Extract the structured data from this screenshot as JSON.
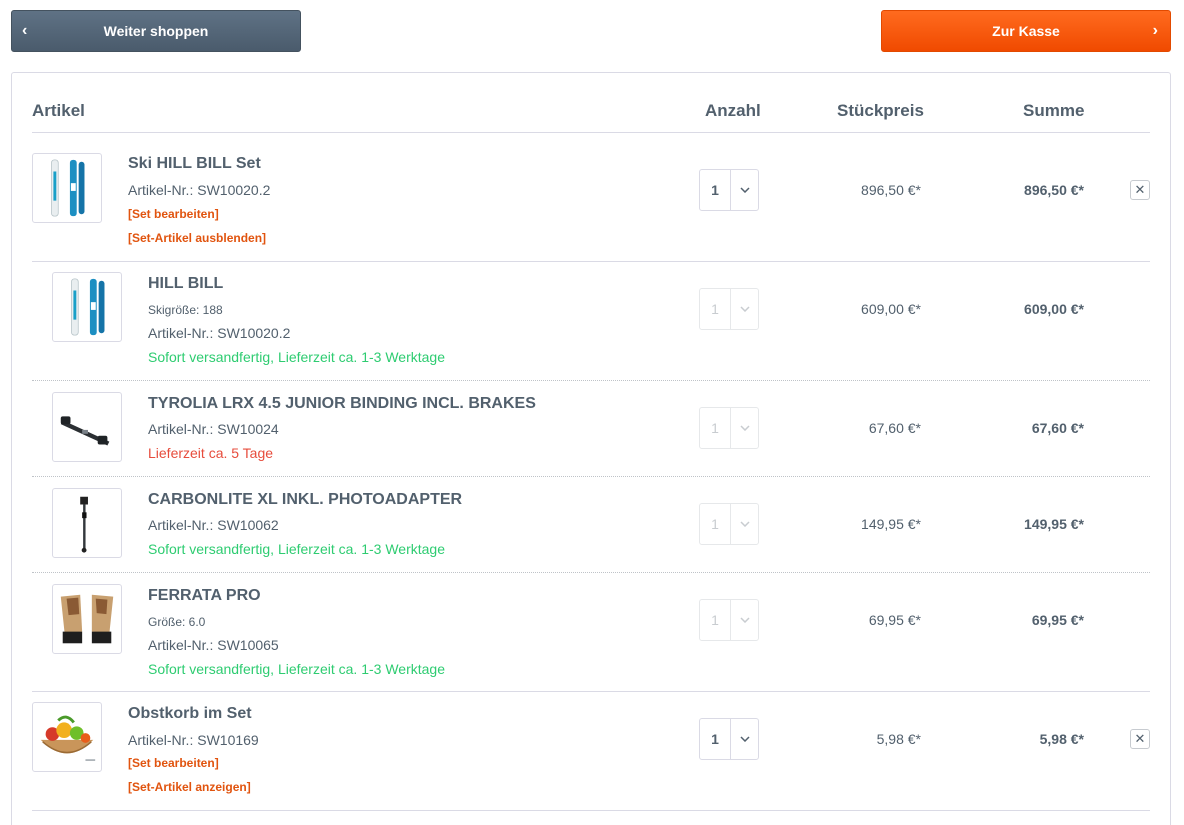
{
  "top_bar": {
    "back_label": "Weiter shoppen",
    "checkout_label": "Zur Kasse"
  },
  "table_header": {
    "artikel": "Artikel",
    "anzahl": "Anzahl",
    "stueckpreis": "Stückpreis",
    "summe": "Summe"
  },
  "items": [
    {
      "name": "Ski HILL BILL Set",
      "article_no": "Artikel-Nr.: SW10020.2",
      "edit_set": "[Set bearbeiten]",
      "toggle_set": "[Set-Artikel ausblenden]",
      "qty": "1",
      "unit_price": "896,50 €*",
      "total": "896,50 €*",
      "remove_icon": "close-icon"
    },
    {
      "name": "HILL BILL",
      "variant": "Skigröße: 188",
      "article_no": "Artikel-Nr.: SW10020.2",
      "delivery": "Sofort versandfertig, Lieferzeit ca. 1-3 Werktage",
      "qty": "1",
      "unit_price": "609,00 €*",
      "total": "609,00 €*"
    },
    {
      "name": "TYROLIA LRX 4.5 JUNIOR BINDING INCL. BRAKES",
      "article_no": "Artikel-Nr.: SW10024",
      "delivery": "Lieferzeit ca. 5 Tage",
      "qty": "1",
      "unit_price": "67,60 €*",
      "total": "67,60 €*"
    },
    {
      "name": "CARBONLITE XL INKL. PHOTOADAPTER",
      "article_no": "Artikel-Nr.: SW10062",
      "delivery": "Sofort versandfertig, Lieferzeit ca. 1-3 Werktage",
      "qty": "1",
      "unit_price": "149,95 €*",
      "total": "149,95 €*"
    },
    {
      "name": "FERRATA PRO",
      "variant": "Größe: 6.0",
      "article_no": "Artikel-Nr.: SW10065",
      "delivery": "Sofort versandfertig, Lieferzeit ca. 1-3 Werktage",
      "qty": "1",
      "unit_price": "69,95 €*",
      "total": "69,95 €*"
    },
    {
      "name": "Obstkorb im Set",
      "article_no": "Artikel-Nr.: SW10169",
      "edit_set": "[Set bearbeiten]",
      "toggle_set": "[Set-Artikel anzeigen]",
      "qty": "1",
      "unit_price": "5,98 €*",
      "total": "5,98 €*",
      "remove_icon": "close-icon"
    }
  ],
  "colors": {
    "accent_orange": "#f04a00",
    "back_button": "#4a5b6c",
    "link_orange": "#e1540f",
    "in_stock_green": "#2ecc71",
    "delay_red": "#e74c3c",
    "text": "#52606d",
    "border": "#dadae5"
  }
}
